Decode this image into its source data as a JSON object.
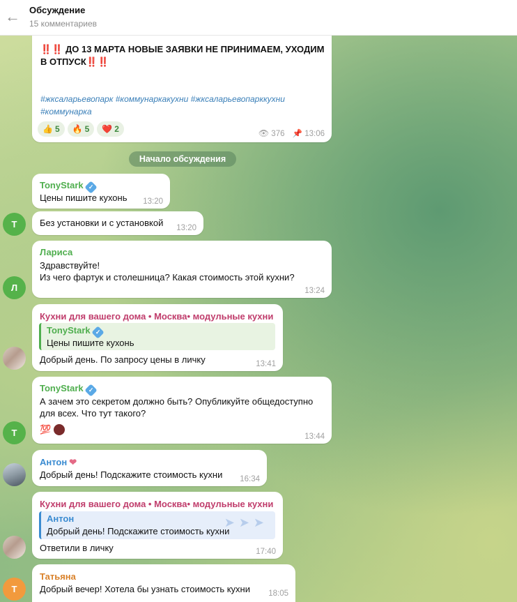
{
  "header": {
    "title": "Обсуждение",
    "subtitle": "15 комментариев",
    "back_icon": "arrow-left-icon"
  },
  "post": {
    "text_line1": "‼️‼️ ДО 13 МАРТА НОВЫЕ ЗАЯВКИ НЕ ПРИНИМАЕМ, УХОДИМ",
    "text_line2": "В ОТПУСК‼️‼️",
    "tags_line1": "#жксаларьевопарк #коммунаркакухни #жксаларьевопарккухни",
    "tags_line2": "#коммунарка",
    "reactions": [
      {
        "emoji": "👍",
        "count": "5"
      },
      {
        "emoji": "🔥",
        "count": "5"
      },
      {
        "emoji": "❤️",
        "count": "2"
      }
    ],
    "views": "376",
    "time": "13:06"
  },
  "divider": "Начало обсуждения",
  "messages": [
    {
      "sender": "TonyStark",
      "text": "Цены пишите кухонь",
      "time": "13:20"
    },
    {
      "text": "Без установки и с установкой",
      "time": "13:20",
      "avatar": "Т"
    },
    {
      "sender": "Лариса",
      "line1": "Здравствуйте!",
      "line2": "Из чего фартук и столешница? Какая стоимость этой кухни?",
      "time": "13:24",
      "avatar": "Л"
    },
    {
      "sender": "Кухни для вашего дома • Москва• модульные кухни",
      "reply_name": "TonyStark",
      "reply_text": "Цены пишите кухонь",
      "text": "Добрый день. По запросу цены в личку",
      "time": "13:41"
    },
    {
      "sender": "TonyStark",
      "line1": "А зачем это секретом должно быть? Опубликуйте общедоступно",
      "line2": "для всех. Что тут такого?",
      "reaction": "💯",
      "time": "13:44",
      "avatar": "Т"
    },
    {
      "sender": "Антон",
      "text": "Добрый день! Подскажите стоимость кухни",
      "time": "16:34"
    },
    {
      "sender": "Кухни для вашего дома • Москва• модульные кухни",
      "reply_name": "Антон",
      "reply_text": "Добрый день! Подскажите стоимость кухни",
      "text": "Ответили в личку",
      "time": "17:40"
    },
    {
      "sender": "Татьяна",
      "text": "Добрый вечер! Хотела бы узнать стоимость кухни",
      "time": "18:05",
      "avatar": "Т"
    }
  ],
  "colors": {
    "sender_green": "#4fae4e",
    "sender_pink": "#c03d6c",
    "sender_blue": "#3a8bd1",
    "sender_orange": "#d9822b"
  }
}
